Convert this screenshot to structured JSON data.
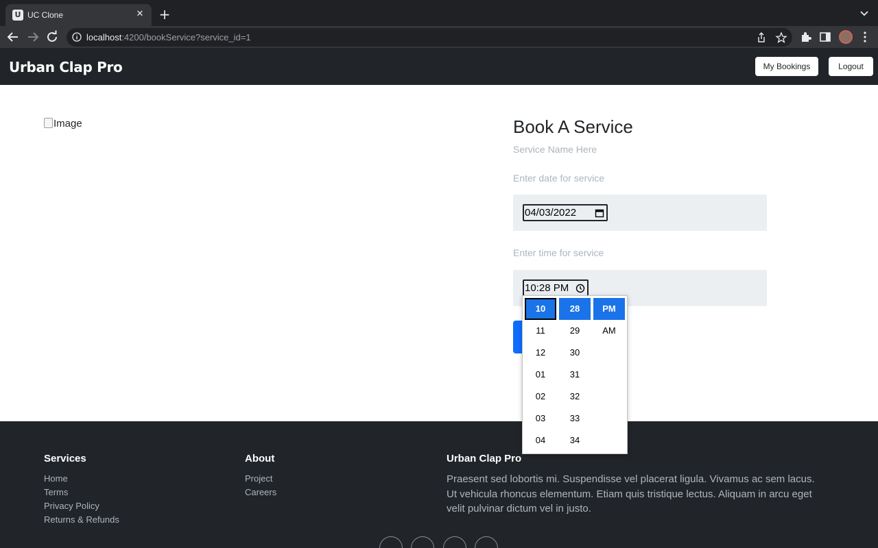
{
  "browser": {
    "tab_title": "UC Clone",
    "favicon_text": "U",
    "url_host": "localhost",
    "url_rest": ":4200/bookService?service_id=1"
  },
  "navbar": {
    "brand": "Urban Clap Pro",
    "my_bookings_label": "My Bookings",
    "logout_label": "Logout"
  },
  "main": {
    "image_alt": "Image",
    "title": "Book A Service",
    "service_name": "Service Name Here",
    "date_label": "Enter date for service",
    "date_value": "04/03/2022",
    "time_label": "Enter time for service",
    "time_value": "10:28 PM"
  },
  "time_picker": {
    "hours": [
      "10",
      "11",
      "12",
      "01",
      "02",
      "03",
      "04"
    ],
    "minutes": [
      "28",
      "29",
      "30",
      "31",
      "32",
      "33",
      "34"
    ],
    "meridiem": [
      "PM",
      "AM"
    ],
    "selected_hour": "10",
    "selected_minute": "28",
    "selected_meridiem": "PM",
    "accent_color": "#1a73e8"
  },
  "footer": {
    "services_heading": "Services",
    "services_links": [
      "Home",
      "Terms",
      "Privacy Policy",
      "Returns & Refunds"
    ],
    "about_heading": "About",
    "about_links": [
      "Project",
      "Careers"
    ],
    "brand_heading": "Urban Clap Pro",
    "brand_text": "Praesent sed lobortis mi. Suspendisse vel placerat ligula. Vivamus ac sem lacus. Ut vehicula rhoncus elementum. Etiam quis tristique lectus. Aliquam in arcu eget velit pulvinar dictum vel in justo."
  },
  "colors": {
    "navbar_bg": "#212529",
    "primary_button": "#0d6efd",
    "field_bg": "#ebeff2"
  }
}
